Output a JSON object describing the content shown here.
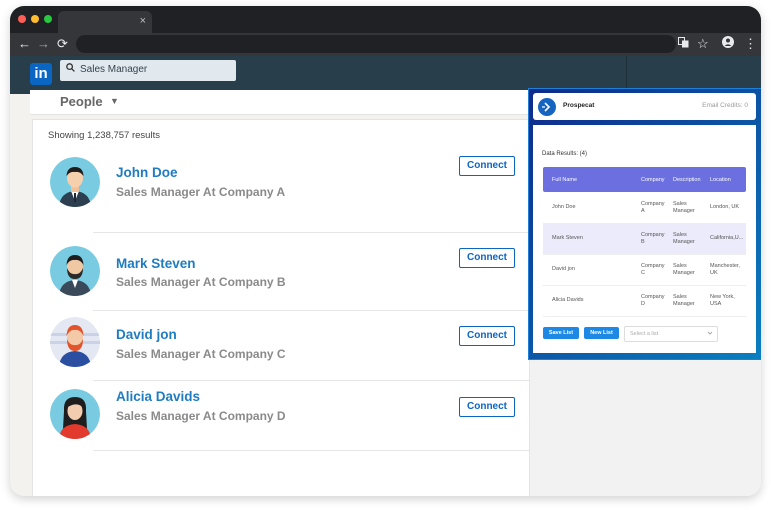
{
  "browser": {
    "tab_close": "×",
    "nav_back": "←",
    "nav_forward": "→",
    "nav_reload": "⟳",
    "star": "☆",
    "menu": "⋮"
  },
  "linkedin": {
    "logo": "in",
    "search_value": "Sales Manager",
    "filter_label": "People",
    "filter_caret": "▼",
    "results_count": "Showing 1,238,757 results",
    "people": [
      {
        "name": "John Doe",
        "title": "Sales Manager At Company A",
        "connect": "Connect"
      },
      {
        "name": "Mark Steven",
        "title": "Sales Manager At Company B",
        "connect": "Connect"
      },
      {
        "name": "David jon",
        "title": "Sales Manager At Company C",
        "connect": "Connect"
      },
      {
        "name": "Alicia Davids",
        "title": "Sales Manager At Company D",
        "connect": "Connect"
      }
    ]
  },
  "prospecat": {
    "name": "Prospecat",
    "credits": "Email Credits: 0",
    "data_results": "Data Results: (4)",
    "columns": [
      "Full Name",
      "Company",
      "Description",
      "Location"
    ],
    "rows": [
      {
        "name": "John Doe",
        "company": "Company A",
        "description": "Sales Manager",
        "location": "London, UK"
      },
      {
        "name": "Mark Steven",
        "company": "Company B",
        "description": "Sales Manager",
        "location": "California,U..."
      },
      {
        "name": "David jon",
        "company": "Company C",
        "description": "Sales Manager",
        "location": "Manchester, UK"
      },
      {
        "name": "Alicia Davids",
        "company": "Company D",
        "description": "Sales Manager",
        "location": "New York, USA"
      }
    ],
    "save_list": "Save List",
    "new_list": "New List",
    "select_placeholder": "Select a list"
  },
  "colors": {
    "linkedin_blue": "#0a66c2",
    "header_navy": "#283e4a",
    "name_blue": "#1f7cc1",
    "table_header": "#6b6fe0",
    "button_blue": "#1e88e5"
  }
}
